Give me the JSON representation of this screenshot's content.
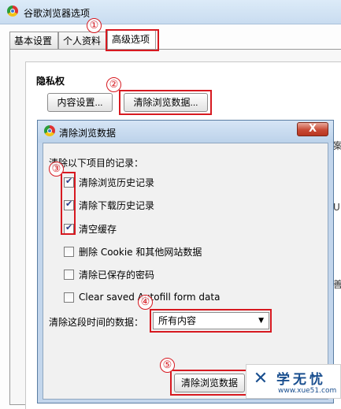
{
  "window": {
    "title": "谷歌浏览器选项"
  },
  "tabs": [
    {
      "label": "基本设置"
    },
    {
      "label": "个人资料"
    },
    {
      "label": "高级选项"
    }
  ],
  "privacy": {
    "title": "隐私权",
    "content_settings_label": "内容设置...",
    "clear_data_label": "清除浏览数据..."
  },
  "dialog": {
    "title": "清除浏览数据",
    "close_label": "X",
    "heading": "清除以下项目的记录：",
    "items": [
      {
        "label": "清除浏览历史记录",
        "checked": true
      },
      {
        "label": "清除下载历史记录",
        "checked": true
      },
      {
        "label": "清空缓存",
        "checked": true
      },
      {
        "label": "删除 Cookie 和其他网站数据",
        "checked": false
      },
      {
        "label": "清除已保存的密码",
        "checked": false
      },
      {
        "label": "Clear saved Autofill form data",
        "checked": false
      }
    ],
    "range_label": "清除这段时间的数据：",
    "range_value": "所有内容",
    "clear_button_label": "清除浏览数据"
  },
  "steps": [
    "①",
    "②",
    "③",
    "④",
    "⑤"
  ],
  "clipped_text": [
    "案",
    "U",
    "善"
  ],
  "watermark": {
    "text": "学无忧",
    "url": "www.xue51.com"
  },
  "colors": {
    "annotation": "#d71920",
    "titlebar": "#c3d6ec"
  }
}
